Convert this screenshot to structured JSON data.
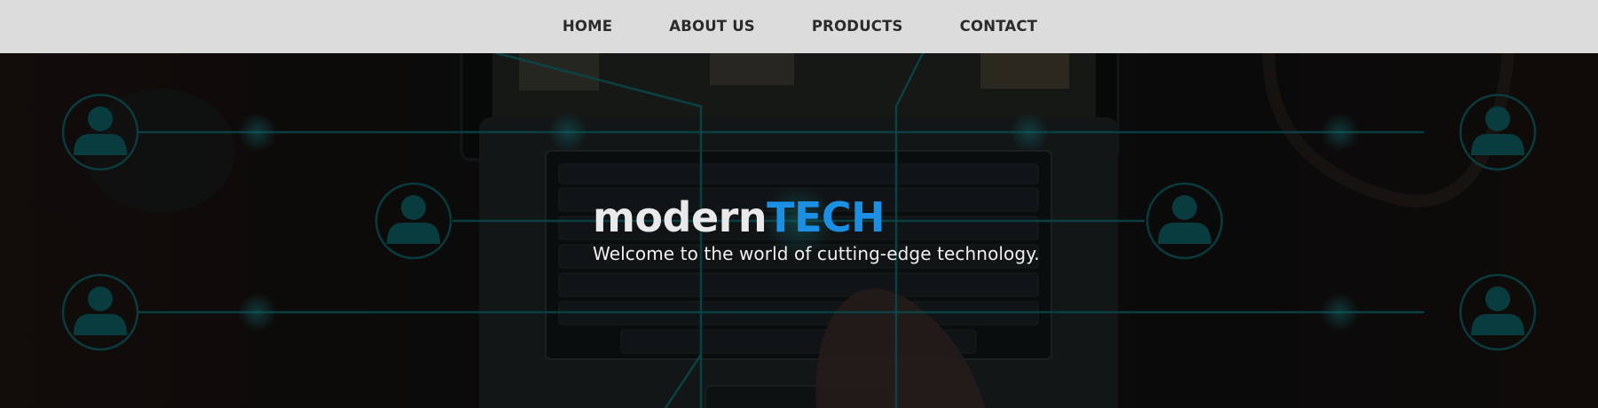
{
  "nav": {
    "items": [
      {
        "label": "HOME"
      },
      {
        "label": "ABOUT US"
      },
      {
        "label": "PRODUCTS"
      },
      {
        "label": "CONTACT"
      }
    ]
  },
  "hero": {
    "brand_part1": "modern",
    "brand_part2": "TECH",
    "tagline": "Welcome to the world of cutting-edge technology."
  },
  "colors": {
    "nav_background": "#dcdcdc",
    "nav_text": "#2b2b2b",
    "brand_white": "#e9e9e9",
    "brand_accent": "#1a8fe3",
    "network_line": "#0f6e73"
  },
  "icons": [
    "user-node-icon"
  ]
}
